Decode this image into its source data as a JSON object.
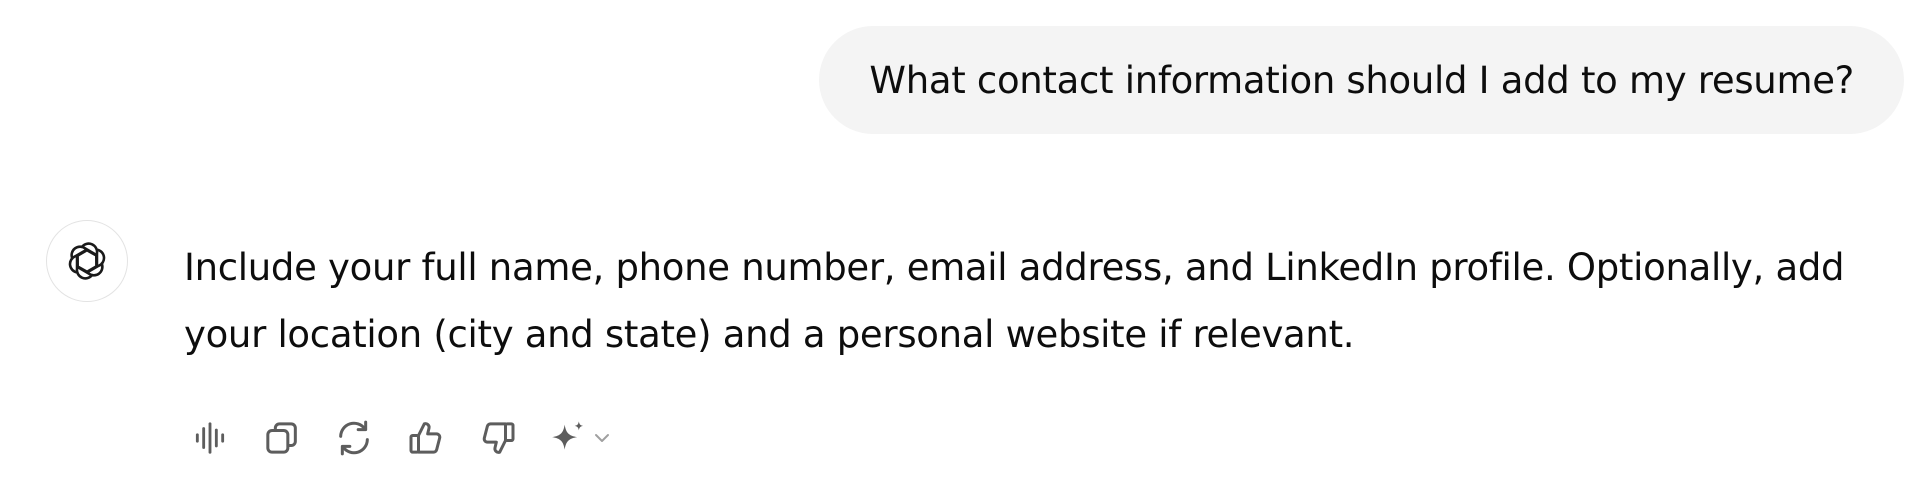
{
  "conversation": {
    "user_message": "What contact information should I add to my resume?",
    "assistant_message": "Include your full name, phone number, email address, and LinkedIn profile. Optionally, add your location (city and state) and a personal website if relevant."
  },
  "assistant": {
    "avatar_icon": "openai-logo-icon"
  },
  "actions": [
    {
      "name": "read-aloud-button",
      "icon": "voice-waveform-icon"
    },
    {
      "name": "copy-button",
      "icon": "copy-icon"
    },
    {
      "name": "regenerate-button",
      "icon": "refresh-icon"
    },
    {
      "name": "thumbs-up-button",
      "icon": "thumbs-up-icon"
    },
    {
      "name": "thumbs-down-button",
      "icon": "thumbs-down-icon"
    },
    {
      "name": "switch-model-button",
      "icon": "sparkle-icon"
    }
  ],
  "colors": {
    "bubble_bg": "#f4f4f4",
    "text": "#0d0d0d",
    "icon": "#5d5d5d"
  }
}
